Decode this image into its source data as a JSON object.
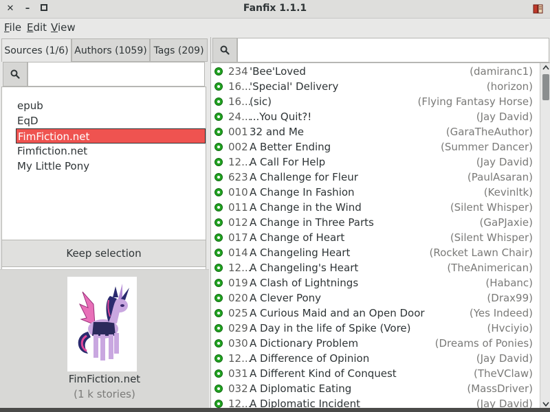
{
  "window": {
    "title": "Fanfix 1.1.1",
    "close_glyph": "✕",
    "minimize_glyph": "–",
    "maximize_glyph": "□",
    "app_icon": "book-icon"
  },
  "menu": {
    "file": {
      "accel": "F",
      "rest": "ile"
    },
    "edit": {
      "accel": "E",
      "rest": "dit"
    },
    "view": {
      "accel": "V",
      "rest": "iew"
    }
  },
  "tabs": [
    {
      "label": "Sources (1/6)",
      "active": true
    },
    {
      "label": "Authors (1059)",
      "active": false
    },
    {
      "label": "Tags (209)",
      "active": false
    }
  ],
  "left_search": {
    "value": "",
    "placeholder": ""
  },
  "sources": [
    {
      "label": "epub",
      "selected": false
    },
    {
      "label": "EqD",
      "selected": false
    },
    {
      "label": "FimFiction.net",
      "selected": true
    },
    {
      "label": "Fimfiction.net",
      "selected": false
    },
    {
      "label": "My Little Pony",
      "selected": false
    }
  ],
  "keep_selection_label": "Keep selection",
  "selected_source": {
    "title": "FimFiction.net",
    "count": "(1 k stories)"
  },
  "right_search": {
    "value": "",
    "placeholder": ""
  },
  "colors": {
    "selection": "#ef5350",
    "status_dot": "#22a322"
  },
  "stories": [
    {
      "num": "234",
      "title": "'Bee'Loved",
      "author": "(damiranc1)"
    },
    {
      "num": "16...",
      "title": "'Special' Delivery",
      "author": "(horizon)"
    },
    {
      "num": "16...",
      "title": "(sic)",
      "author": "(Flying Fantasy Horse)"
    },
    {
      "num": "24...",
      "title": "...You Quit?!",
      "author": "(Jay David)"
    },
    {
      "num": "001",
      "title": "32 and Me",
      "author": "(GaraTheAuthor)"
    },
    {
      "num": "002",
      "title": "A Better Ending",
      "author": "(Summer Dancer)"
    },
    {
      "num": "12...",
      "title": "A Call For Help",
      "author": "(Jay David)"
    },
    {
      "num": "623",
      "title": "A Challenge for Fleur",
      "author": "(PaulAsaran)"
    },
    {
      "num": "010",
      "title": "A Change In Fashion",
      "author": "(Kevinltk)"
    },
    {
      "num": "011",
      "title": "A Change in the Wind",
      "author": "(Silent Whisper)"
    },
    {
      "num": "012",
      "title": "A Change in Three Parts",
      "author": "(GaPJaxie)"
    },
    {
      "num": "017",
      "title": "A Change of Heart",
      "author": "(Silent Whisper)"
    },
    {
      "num": "014",
      "title": "A Changeling Heart",
      "author": "(Rocket Lawn Chair)"
    },
    {
      "num": "12...",
      "title": "A Changeling's Heart",
      "author": "(TheAnimerican)"
    },
    {
      "num": "019",
      "title": "A Clash of Lightnings",
      "author": "(Habanc)"
    },
    {
      "num": "020",
      "title": "A Clever Pony",
      "author": "(Drax99)"
    },
    {
      "num": "025",
      "title": "A Curious Maid and an Open Door",
      "author": "(Yes Indeed)"
    },
    {
      "num": "029",
      "title": "A Day in the life of Spike (Vore)",
      "author": "(Hvciyio)"
    },
    {
      "num": "030",
      "title": "A Dictionary Problem",
      "author": "(Dreams of Ponies)"
    },
    {
      "num": "12...",
      "title": "A Difference of Opinion",
      "author": "(Jay David)"
    },
    {
      "num": "031",
      "title": "A Different Kind of Conquest",
      "author": "(TheVClaw)"
    },
    {
      "num": "032",
      "title": "A Diplomatic Eating",
      "author": "(MassDriver)"
    },
    {
      "num": "12...",
      "title": "A Diplomatic Incident",
      "author": "(Jay David)"
    }
  ]
}
